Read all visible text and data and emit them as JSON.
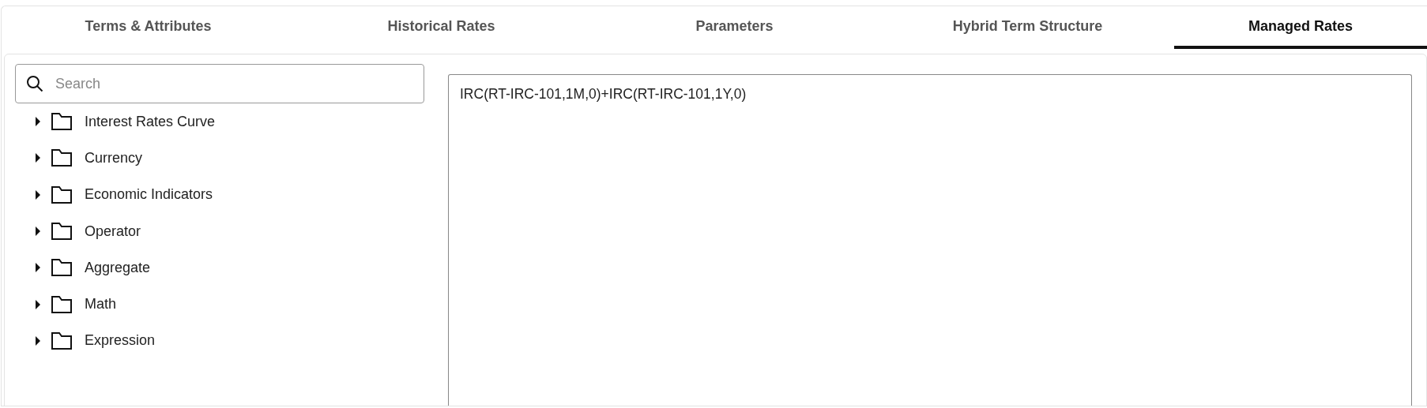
{
  "tabs": [
    {
      "label": "Terms & Attributes",
      "selected": false
    },
    {
      "label": "Historical Rates",
      "selected": false
    },
    {
      "label": "Parameters",
      "selected": false
    },
    {
      "label": "Hybrid Term Structure",
      "selected": false
    },
    {
      "label": "Managed Rates",
      "selected": true
    }
  ],
  "search": {
    "placeholder": "Search"
  },
  "tree": [
    {
      "label": "Interest Rates Curve",
      "expanded": false
    },
    {
      "label": "Currency",
      "expanded": false
    },
    {
      "label": "Economic Indicators",
      "expanded": false
    },
    {
      "label": "Operator",
      "expanded": false
    },
    {
      "label": "Aggregate",
      "expanded": false
    },
    {
      "label": "Math",
      "expanded": false
    },
    {
      "label": "Expression",
      "expanded": false
    }
  ],
  "editor": {
    "value": "IRC(RT-IRC-101,1M,0)+IRC(RT-IRC-101,1Y,0)"
  }
}
